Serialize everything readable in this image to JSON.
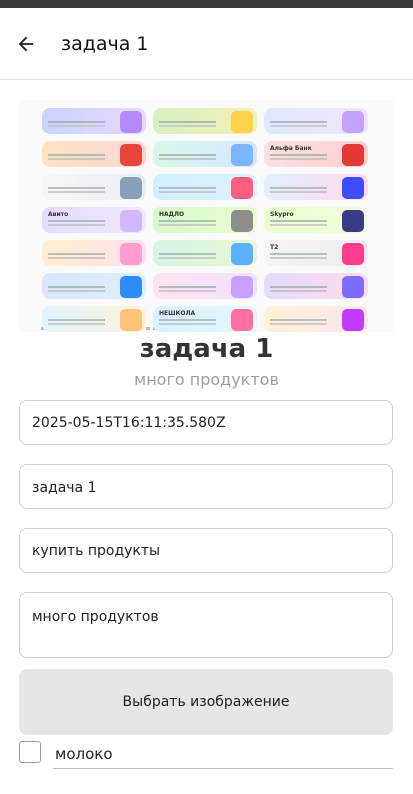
{
  "appbar": {
    "title": "задача 1",
    "back_icon": "arrow-left-icon"
  },
  "banner": {
    "cards": [
      {
        "brand": "",
        "from": "#c9d3ff",
        "to": "#e7d9ff",
        "art": "#b48bff"
      },
      {
        "brand": "",
        "from": "#d8f0c2",
        "to": "#f3f0b8",
        "art": "#ffd24d"
      },
      {
        "brand": "",
        "from": "#dfe8ff",
        "to": "#f0e6ff",
        "art": "#c2a3ff"
      },
      {
        "brand": "",
        "from": "#ffe3c2",
        "to": "#ffd6d6",
        "art": "#e8453c"
      },
      {
        "brand": "",
        "from": "#d9f7ec",
        "to": "#d7e6ff",
        "art": "#7ab7ff"
      },
      {
        "brand": "Альфа Банк",
        "from": "#ffe0e0",
        "to": "#ffd0d0",
        "art": "#e53935"
      },
      {
        "brand": "",
        "from": "#f6f6f6",
        "to": "#e8eef5",
        "art": "#8aa0b8"
      },
      {
        "brand": "",
        "from": "#d3efff",
        "to": "#dff2ff",
        "art": "#ff5f7e"
      },
      {
        "brand": "",
        "from": "#e2f0ff",
        "to": "#ffd9ec",
        "art": "#3b4dff"
      },
      {
        "brand": "Авито",
        "from": "#e6dcff",
        "to": "#f1e8ff",
        "art": "#d3b8ff"
      },
      {
        "brand": "НАДЛО",
        "from": "#d9f7c9",
        "to": "#eaffd2",
        "art": "#8e8e8e"
      },
      {
        "brand": "Skypro",
        "from": "#e8ffd1",
        "to": "#f2ffd8",
        "art": "#3a3a8a"
      },
      {
        "brand": "",
        "from": "#fff0cc",
        "to": "#ffe0f0",
        "art": "#ff9ecf"
      },
      {
        "brand": "",
        "from": "#d5f3e6",
        "to": "#e9f7d0",
        "art": "#5bb0ff"
      },
      {
        "brand": "T2",
        "from": "#f5f5f5",
        "to": "#ececec",
        "art": "#ff3d8d"
      },
      {
        "brand": "",
        "from": "#d8e6ff",
        "to": "#e0eeff",
        "art": "#2f8cff"
      },
      {
        "brand": "",
        "from": "#ffe3f0",
        "to": "#f0e2ff",
        "art": "#c9a0ff"
      },
      {
        "brand": "",
        "from": "#e4dbff",
        "to": "#ffdbe7",
        "art": "#7c6cff"
      },
      {
        "brand": "",
        "from": "#e0f4ff",
        "to": "#fff2d8",
        "art": "#ffc276"
      },
      {
        "brand": "НЕШКОЛА",
        "from": "#d9f2ff",
        "to": "#e4f6ff",
        "art": "#ff6fa0"
      },
      {
        "brand": "",
        "from": "#fff1d6",
        "to": "#ffe4f2",
        "art": "#c23cff"
      }
    ]
  },
  "task": {
    "title": "задача 1",
    "subtitle": "много продуктов"
  },
  "fields": {
    "date": "2025-05-15T16:11:35.580Z",
    "name": "задача 1",
    "short_desc": "купить продукты",
    "description": "много продуктов"
  },
  "pick_image_label": "Выбрать изображение",
  "checklist": [
    {
      "label": "молоко",
      "checked": false
    }
  ]
}
